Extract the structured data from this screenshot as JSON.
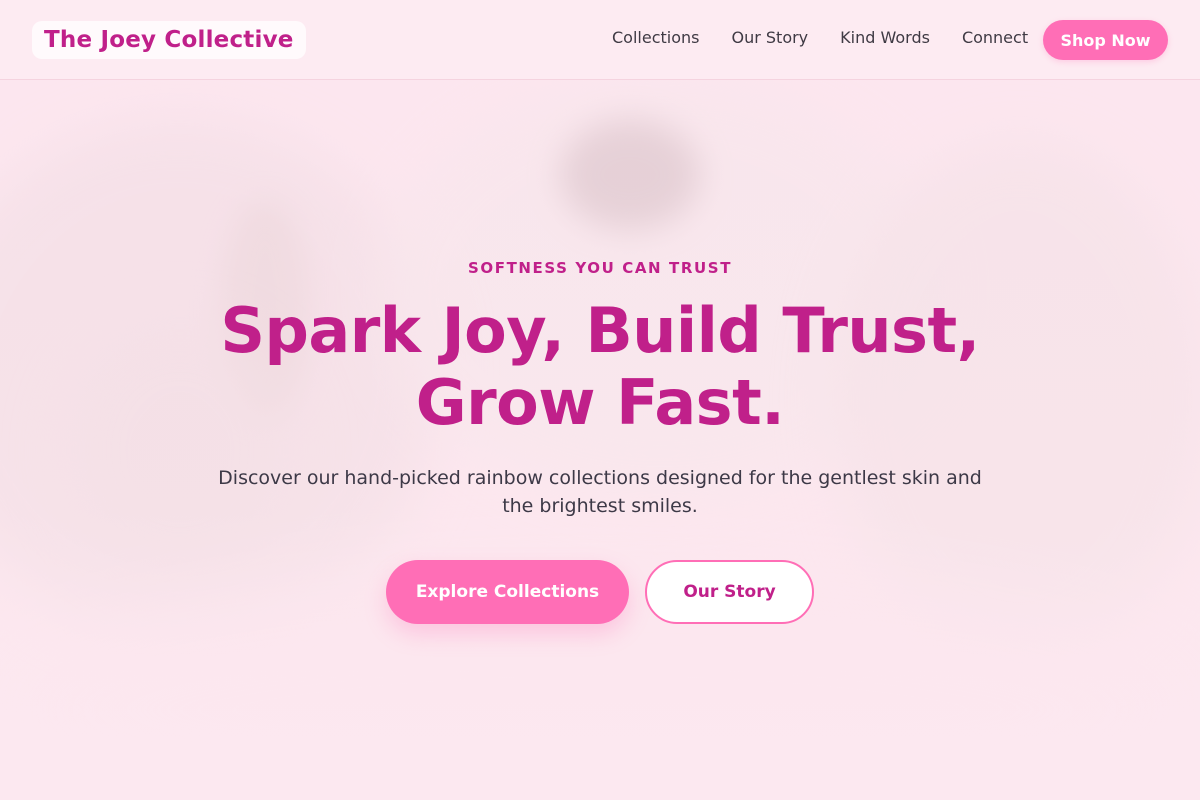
{
  "nav": {
    "brand": "The Joey Collective",
    "links": [
      "Collections",
      "Our Story",
      "Kind Words",
      "Connect"
    ],
    "cta": "Shop Now"
  },
  "hero": {
    "eyebrow": "SOFTNESS YOU CAN TRUST",
    "headline_line1": "Spark Joy, Build Trust,",
    "headline_line2": "Grow Fast.",
    "subtext": "Discover our hand-picked rainbow collections designed for the gentlest skin and the brightest smiles.",
    "primary_cta": "Explore Collections",
    "secondary_cta": "Our Story"
  },
  "colors": {
    "brand_magenta": "#c0208a",
    "accent_pink": "#ff6eb6",
    "background_blush": "#fde9f0",
    "body_text": "#3d3947"
  }
}
